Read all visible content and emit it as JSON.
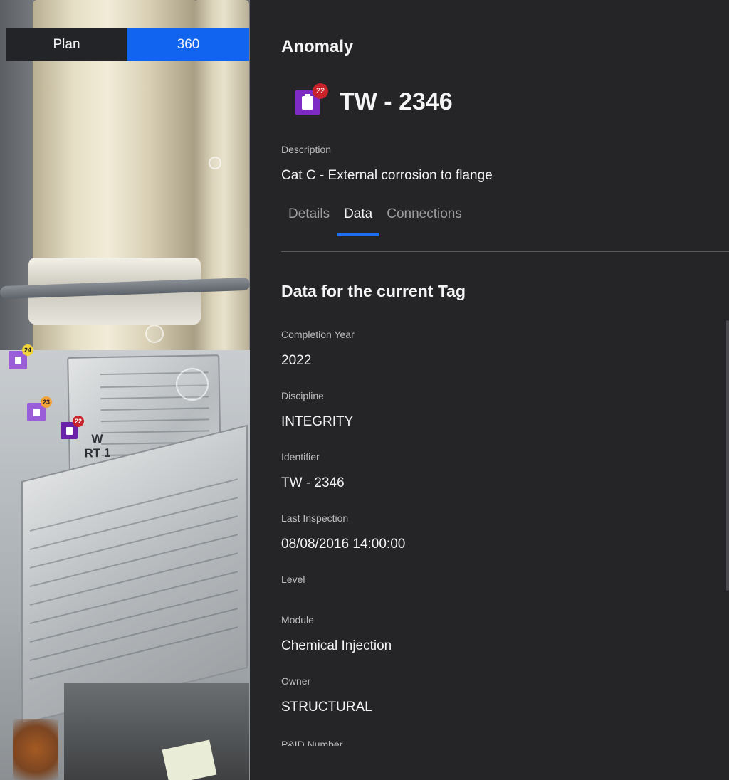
{
  "viewer": {
    "toggle": {
      "plan_label": "Plan",
      "pano_label": "360"
    },
    "markers": [
      {
        "count": "24",
        "color": "#f2d437"
      },
      {
        "count": "23",
        "color": "#f2a33a"
      },
      {
        "count": "22",
        "color": "#c8232b"
      }
    ],
    "plate": {
      "line1": "W",
      "line2": "RT 1"
    }
  },
  "panel": {
    "heading": "Anomaly",
    "tag": {
      "title": "TW - 2346",
      "badge_count": "22",
      "icon": "clipboard-icon",
      "icon_color": "#7e2bc6"
    },
    "description": {
      "label": "Description",
      "value": "Cat C - External corrosion to flange"
    },
    "tabs": [
      {
        "label": "Details",
        "active": false
      },
      {
        "label": "Data",
        "active": true
      },
      {
        "label": "Connections",
        "active": false
      }
    ],
    "section_title": "Data for the current Tag",
    "fields": [
      {
        "label": "Completion Year",
        "value": "2022"
      },
      {
        "label": "Discipline",
        "value": "INTEGRITY"
      },
      {
        "label": "Identifier",
        "value": "TW - 2346"
      },
      {
        "label": "Last Inspection",
        "value": "08/08/2016 14:00:00"
      },
      {
        "label": "Level",
        "value": ""
      },
      {
        "label": "Module",
        "value": "Chemical Injection"
      },
      {
        "label": "Owner",
        "value": "STRUCTURAL"
      }
    ],
    "truncated_label": "P&ID Number",
    "accent_color": "#1e6ef2"
  }
}
